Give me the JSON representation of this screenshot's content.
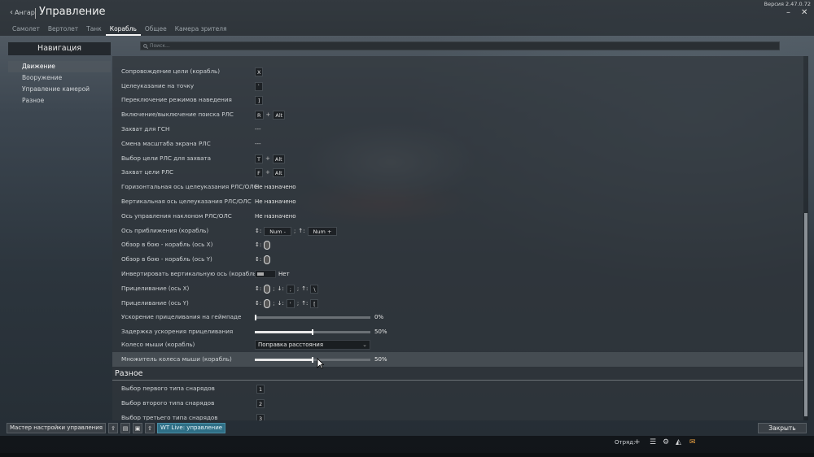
{
  "header": {
    "back_label": "Ангар",
    "title": "Управление",
    "version": "Версия 2.47.0.72"
  },
  "tabs": [
    {
      "label": "Самолет",
      "active": false
    },
    {
      "label": "Вертолет",
      "active": false
    },
    {
      "label": "Танк",
      "active": false
    },
    {
      "label": "Корабль",
      "active": true
    },
    {
      "label": "Общее",
      "active": false
    },
    {
      "label": "Камера зрителя",
      "active": false
    }
  ],
  "search": {
    "placeholder": "Поиск..."
  },
  "nav": {
    "title": "Навигация",
    "items": [
      {
        "label": "Движение",
        "selected": true
      },
      {
        "label": "Вооружение",
        "selected": false
      },
      {
        "label": "Управление камерой",
        "selected": false
      },
      {
        "label": "Разное",
        "selected": false
      }
    ]
  },
  "settings": [
    {
      "label": "Сопровождение цели (корабль)",
      "keys": [
        "X"
      ]
    },
    {
      "label": "Целеуказание на точку",
      "keys": [
        "`"
      ]
    },
    {
      "label": "Переключение режимов наведения",
      "keys": [
        "]"
      ]
    },
    {
      "label": "Включение/выключение поиска РЛС",
      "keys": [
        "R",
        "Alt"
      ]
    },
    {
      "label": "Захват для ГСН",
      "text": "---"
    },
    {
      "label": "Смена масштаба экрана РЛС",
      "text": "---"
    },
    {
      "label": "Выбор цели РЛС для захвата",
      "keys": [
        "T",
        "Alt"
      ]
    },
    {
      "label": "Захват цели РЛС",
      "keys": [
        "F",
        "Alt"
      ]
    },
    {
      "label": "Горизонтальная ось целеуказания РЛС/ОЛС",
      "text": "Не назначено"
    },
    {
      "label": "Вертикальная ось целеуказания РЛС/ОЛС",
      "text": "Не назначено"
    },
    {
      "label": "Ось управления наклоном РЛС/ОЛС",
      "text": "Не назначено"
    },
    {
      "label": "Ось приближения (корабль)",
      "axis_keys": [
        "Num -",
        "Num +"
      ]
    },
    {
      "label": "Обзор в бою - корабль (ось X)",
      "mouse_axis": "x"
    },
    {
      "label": "Обзор в бою - корабль (ось Y)",
      "mouse_axis": "y"
    },
    {
      "label": "Инвертировать вертикальную ось (корабль)",
      "toggle_text": "Нет"
    },
    {
      "label": "Прицеливание (ось X)",
      "mouse_combo": [
        ";",
        "\\"
      ]
    },
    {
      "label": "Прицеливание (ось Y)",
      "mouse_combo": [
        "'",
        "["
      ]
    },
    {
      "label": "Ускорение прицеливания на геймпаде",
      "slider_value": 0,
      "slider_text": "0%"
    },
    {
      "label": "Задержка ускорения прицеливания",
      "slider_value": 50,
      "slider_text": "50%"
    },
    {
      "label": "Колесо мыши (корабль)",
      "select": "Поправка расстояния"
    },
    {
      "label": "Множитель колеса мыши (корабль)",
      "slider_value": 50,
      "slider_text": "50%",
      "highlighted": true
    }
  ],
  "misc": {
    "header": "Разное",
    "items": [
      {
        "label": "Выбор первого типа снарядов",
        "key": "1"
      },
      {
        "label": "Выбор второго типа снарядов",
        "key": "2"
      },
      {
        "label": "Выбор третьего типа снарядов",
        "key": "3"
      }
    ]
  },
  "bottom": {
    "wizard_label": "Мастер настройки управления",
    "live_label": "WT Live: управление",
    "close_label": "Закрыть",
    "squad_label": "Отряд:"
  },
  "icons": [
    "back-chevron-icon",
    "window-minimize-icon",
    "window-close-icon",
    "search-icon",
    "import-icon",
    "file-icon",
    "save-icon",
    "export-icon",
    "add-icon",
    "list-icon",
    "settings-icon",
    "tank-icon",
    "mail-icon"
  ],
  "colors": {
    "accent_live": "#2f6f86",
    "mail": "#e8a040"
  }
}
